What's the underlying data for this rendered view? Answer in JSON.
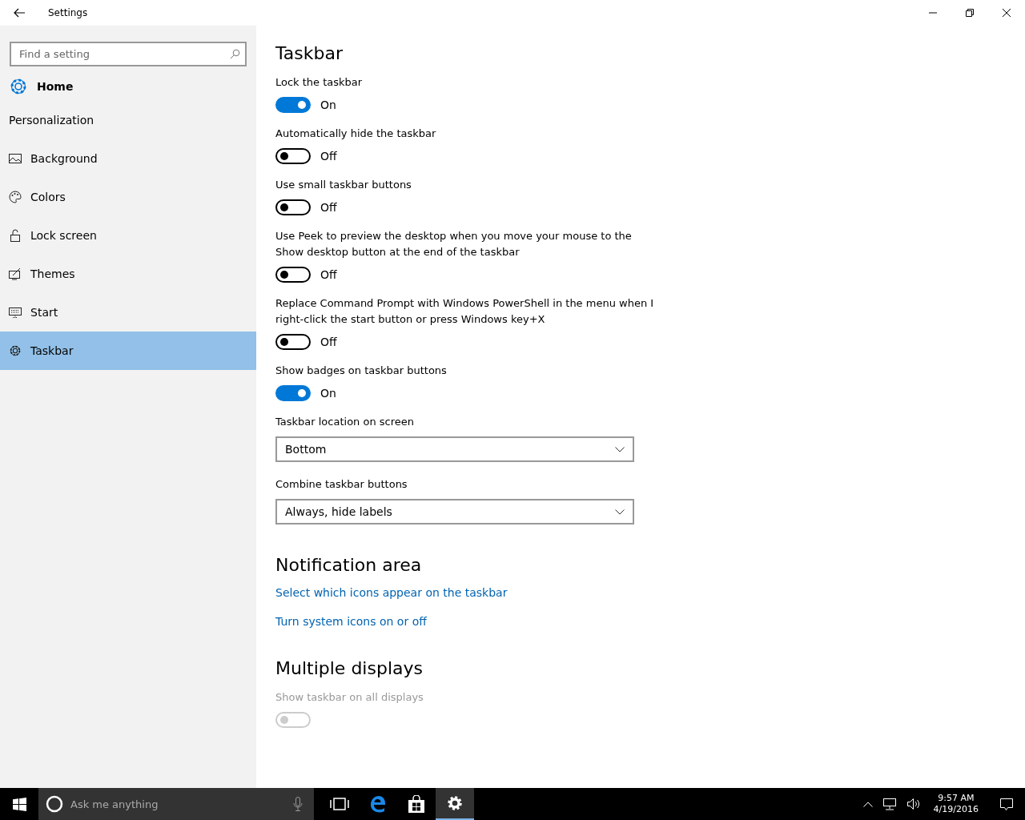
{
  "window": {
    "title": "Settings"
  },
  "sidebar": {
    "search": {
      "placeholder": "Find a setting"
    },
    "home": "Home",
    "section": "Personalization",
    "items": [
      {
        "label": "Background",
        "selected": false
      },
      {
        "label": "Colors",
        "selected": false
      },
      {
        "label": "Lock screen",
        "selected": false
      },
      {
        "label": "Themes",
        "selected": false
      },
      {
        "label": "Start",
        "selected": false
      },
      {
        "label": "Taskbar",
        "selected": true
      }
    ]
  },
  "sections": [
    {
      "title": "Taskbar",
      "settings": [
        {
          "kind": "toggle",
          "label": "Lock the taskbar",
          "on": true,
          "state": "On",
          "disabled": false
        },
        {
          "kind": "toggle",
          "label": "Automatically hide the taskbar",
          "on": false,
          "state": "Off",
          "disabled": false
        },
        {
          "kind": "toggle",
          "label": "Use small taskbar buttons",
          "on": false,
          "state": "Off",
          "disabled": false
        },
        {
          "kind": "toggle",
          "label": "Use Peek to preview the desktop when you move your mouse to the Show desktop button at the end of the taskbar",
          "on": false,
          "state": "Off",
          "disabled": false
        },
        {
          "kind": "toggle",
          "label": "Replace Command Prompt with Windows PowerShell in the menu when I right-click the start button or press Windows key+X",
          "on": false,
          "state": "Off",
          "disabled": false
        },
        {
          "kind": "toggle",
          "label": "Show badges on taskbar buttons",
          "on": true,
          "state": "On",
          "disabled": false
        },
        {
          "kind": "dropdown",
          "label": "Taskbar location on screen",
          "value": "Bottom"
        },
        {
          "kind": "dropdown",
          "label": "Combine taskbar buttons",
          "value": "Always, hide labels"
        }
      ]
    },
    {
      "title": "Notification area",
      "settings": [
        {
          "kind": "link",
          "label": "Select which icons appear on the taskbar"
        },
        {
          "kind": "link",
          "label": "Turn system icons on or off"
        }
      ]
    },
    {
      "title": "Multiple displays",
      "settings": [
        {
          "kind": "toggle",
          "label": "Show taskbar on all displays",
          "on": false,
          "disabled": true
        }
      ]
    }
  ],
  "taskbar": {
    "search_placeholder": "Ask me anything",
    "apps": [
      {
        "selected": false
      },
      {
        "selected": false
      },
      {
        "selected": false
      },
      {
        "selected": true
      }
    ],
    "time": "9:57 AM",
    "date": "4/19/2016"
  }
}
